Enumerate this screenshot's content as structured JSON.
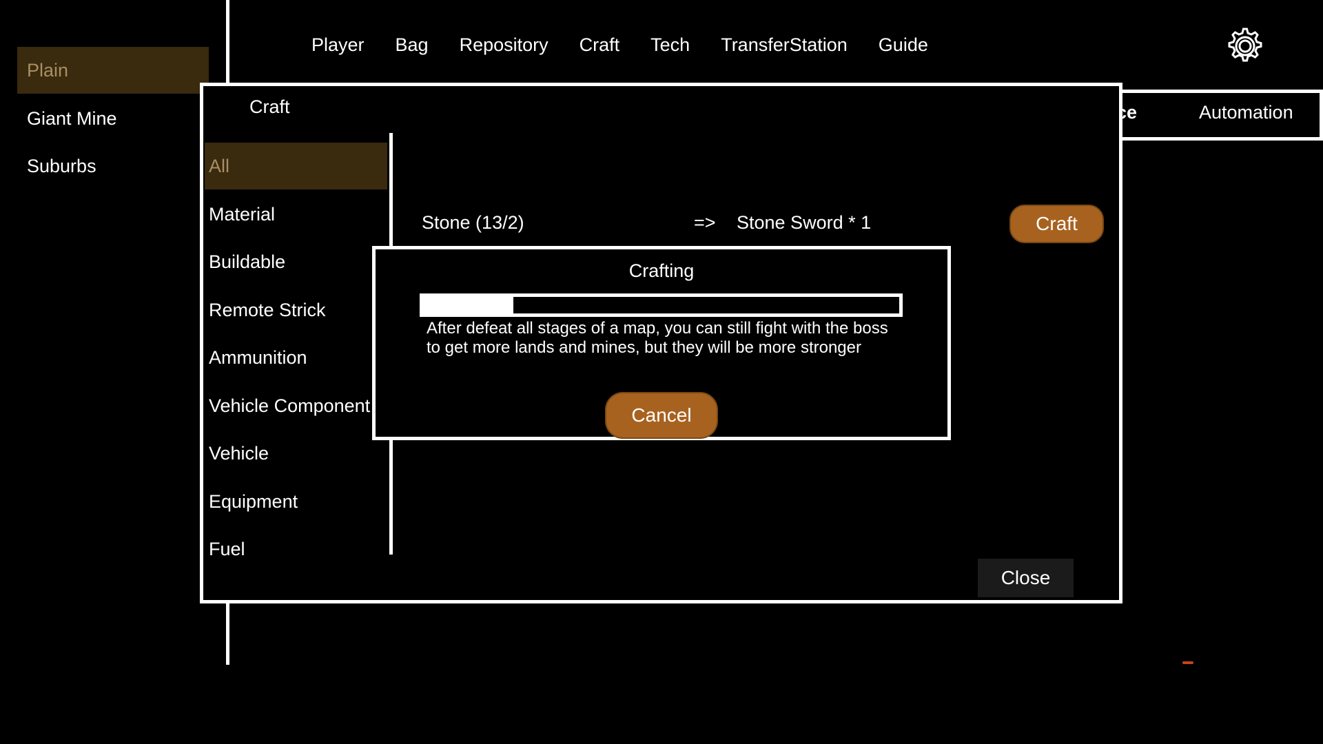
{
  "maps": {
    "items": [
      {
        "label": "Plain",
        "selected": true
      },
      {
        "label": "Giant Mine",
        "selected": false
      },
      {
        "label": "Suburbs",
        "selected": false
      },
      {
        "label": "",
        "hidden": true
      },
      {
        "label": "",
        "hidden": true
      }
    ]
  },
  "topnav": {
    "items": [
      "Player",
      "Bag",
      "Repository",
      "Craft",
      "Tech",
      "TransferStation",
      "Guide"
    ]
  },
  "settings_icon": "gear-icon",
  "background_tabs": {
    "partial_tab": "ce",
    "automation": "Automation"
  },
  "craft_panel": {
    "title": "Craft",
    "categories": [
      "All",
      "Material",
      "Buildable",
      "Remote Strick",
      "Ammunition",
      "Vehicle Component",
      "Vehicle",
      "Equipment",
      "Fuel"
    ],
    "selected_category": "All",
    "recipe": {
      "input": "Stone (13/2)",
      "arrow": "=>",
      "output": "Stone Sword * 1",
      "craft_button": "Craft"
    },
    "close_button": "Close"
  },
  "crafting_dialog": {
    "title": "Crafting",
    "progress": 0.19,
    "tip": "After defeat all stages of a map, you can still fight with the boss to get more lands and mines, but they will be more stronger",
    "cancel_button": "Cancel"
  },
  "colors": {
    "selected_bg": "#3a2a0e",
    "selected_text": "#a98f62",
    "button_brown": "#a8621f",
    "close_bg": "#1b1b1b"
  }
}
